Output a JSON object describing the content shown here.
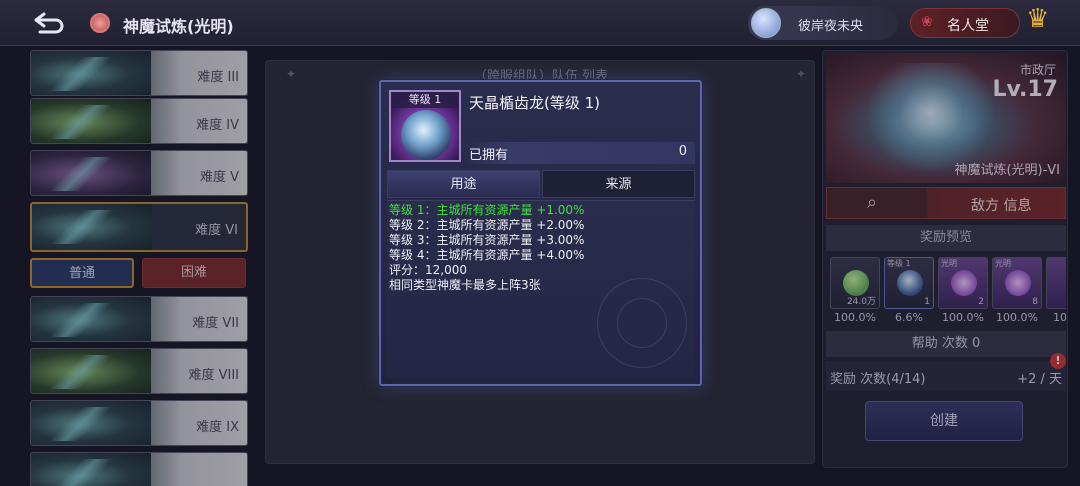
{
  "header": {
    "title": "神魔试炼(光明)",
    "user_name": "彼岸夜未央",
    "hall_label": "名人堂"
  },
  "levels_top": [
    {
      "label": "难度 III"
    },
    {
      "label": "难度 IV"
    },
    {
      "label": "难度 V"
    },
    {
      "label": "难度 VI"
    }
  ],
  "modes": {
    "normal": "普通",
    "hard": "困难"
  },
  "levels_bottom": [
    {
      "label": "难度 VII"
    },
    {
      "label": "难度 VIII"
    },
    {
      "label": "难度 IX"
    }
  ],
  "team_panel": {
    "title": "（跨服组队）队伍 列表"
  },
  "boss": {
    "city_label": "市政厅",
    "level": "Lv.17",
    "name": "神魔试炼(光明)-VI",
    "enemy_info_label": "敌方 信息"
  },
  "rewards": {
    "title": "奖励预览",
    "items": [
      {
        "tag": "",
        "count": "24.0万",
        "pct": "100.0%",
        "color": "#4fa24f"
      },
      {
        "tag": "等级 1",
        "count": "1",
        "pct": "6.6%",
        "color": "#6a8ad6"
      },
      {
        "tag": "光明",
        "count": "2",
        "pct": "100.0%",
        "color": "#c27de0"
      },
      {
        "tag": "光明",
        "count": "8",
        "pct": "100.0%",
        "color": "#c27de0"
      },
      {
        "tag": "",
        "count": "",
        "pct": "10",
        "color": "#c27de0"
      }
    ]
  },
  "help": {
    "label": "帮助 次数 0"
  },
  "reward_count": {
    "label": "奖励 次数(4/14)",
    "rate": "+2 / 天",
    "alert": "!"
  },
  "create_label": "创建",
  "popup": {
    "card_level": "等级 1",
    "name": "天晶楯齿龙(等级 1)",
    "owned_label": "已拥有",
    "owned_count": "0",
    "tabs": [
      "用途",
      "来源"
    ],
    "lines": [
      {
        "text": "等级 1：主城所有资源产量 +1.00%",
        "highlight": true
      },
      {
        "text": "等级 2：主城所有资源产量 +2.00%",
        "highlight": false
      },
      {
        "text": "等级 3：主城所有资源产量 +3.00%",
        "highlight": false
      },
      {
        "text": "等级 4：主城所有资源产量 +4.00%",
        "highlight": false
      },
      {
        "text": "评分：12,000",
        "highlight": false
      },
      {
        "text": "相同类型神魔卡最多上阵3张",
        "highlight": false
      }
    ]
  }
}
